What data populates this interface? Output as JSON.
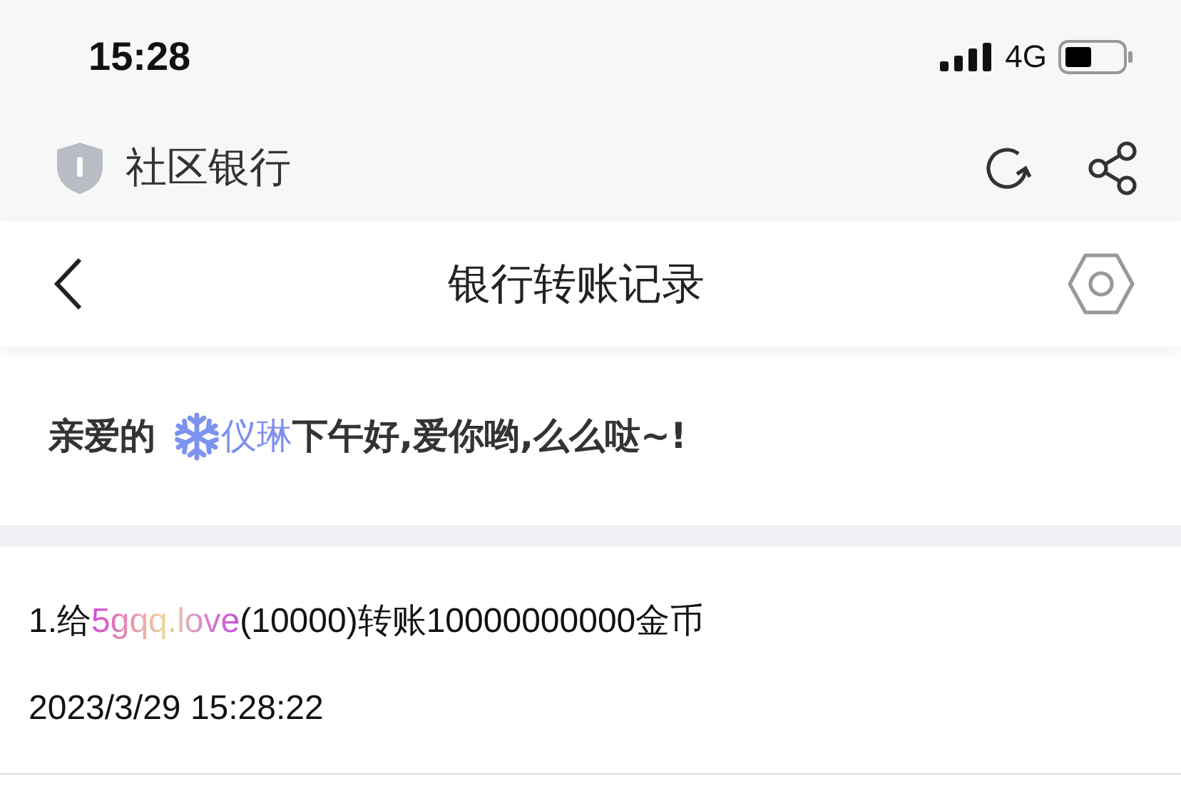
{
  "status_bar": {
    "time": "15:28",
    "network": "4G"
  },
  "app_header": {
    "title": "社区银行"
  },
  "nav_bar": {
    "title": "银行转账记录"
  },
  "greeting": {
    "prefix": "亲爱的",
    "name": "仪琳",
    "message": "下午好,爱你哟,么么哒~!"
  },
  "records": [
    {
      "prefix": "1.给",
      "recipient": "5gqq.love",
      "suffix": "(10000)转账10000000000金币",
      "time": "2023/3/29 15:28:22"
    }
  ]
}
